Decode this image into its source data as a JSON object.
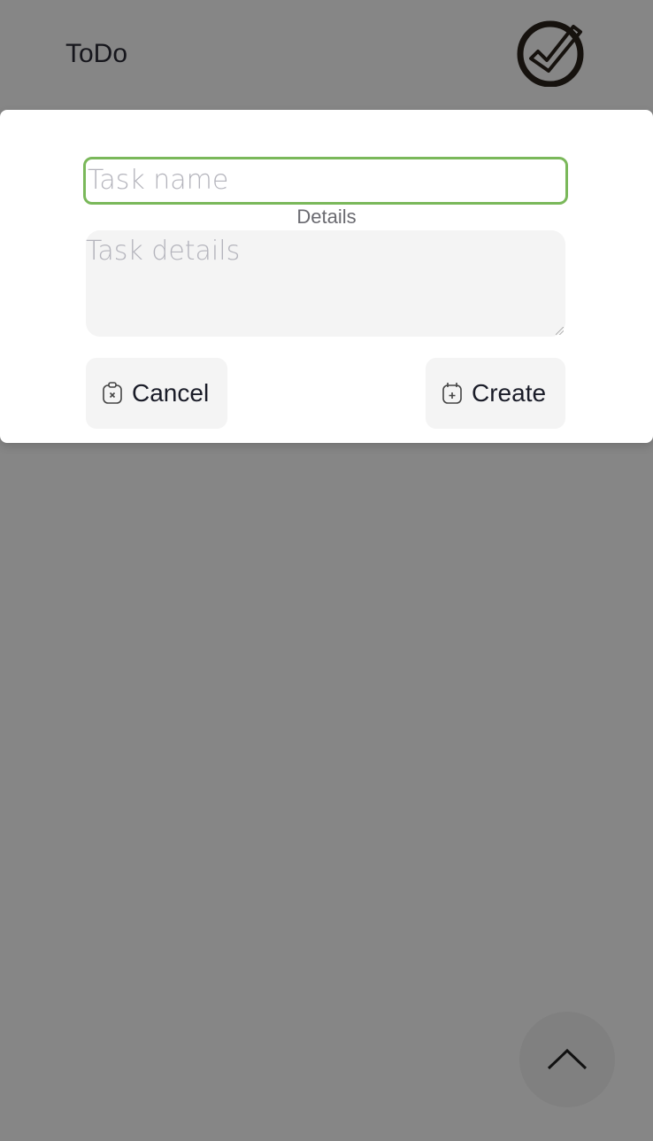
{
  "header": {
    "title": "ToDo",
    "logo_icon": "checkmark-circle-logo"
  },
  "form": {
    "task_name_placeholder": "Task name",
    "details_label": "Details",
    "task_details_placeholder": "Task details",
    "cancel_label": "Cancel",
    "create_label": "Create",
    "focus_color": "#7ab85a"
  },
  "scroll_top_icon": "chevron-up-icon"
}
